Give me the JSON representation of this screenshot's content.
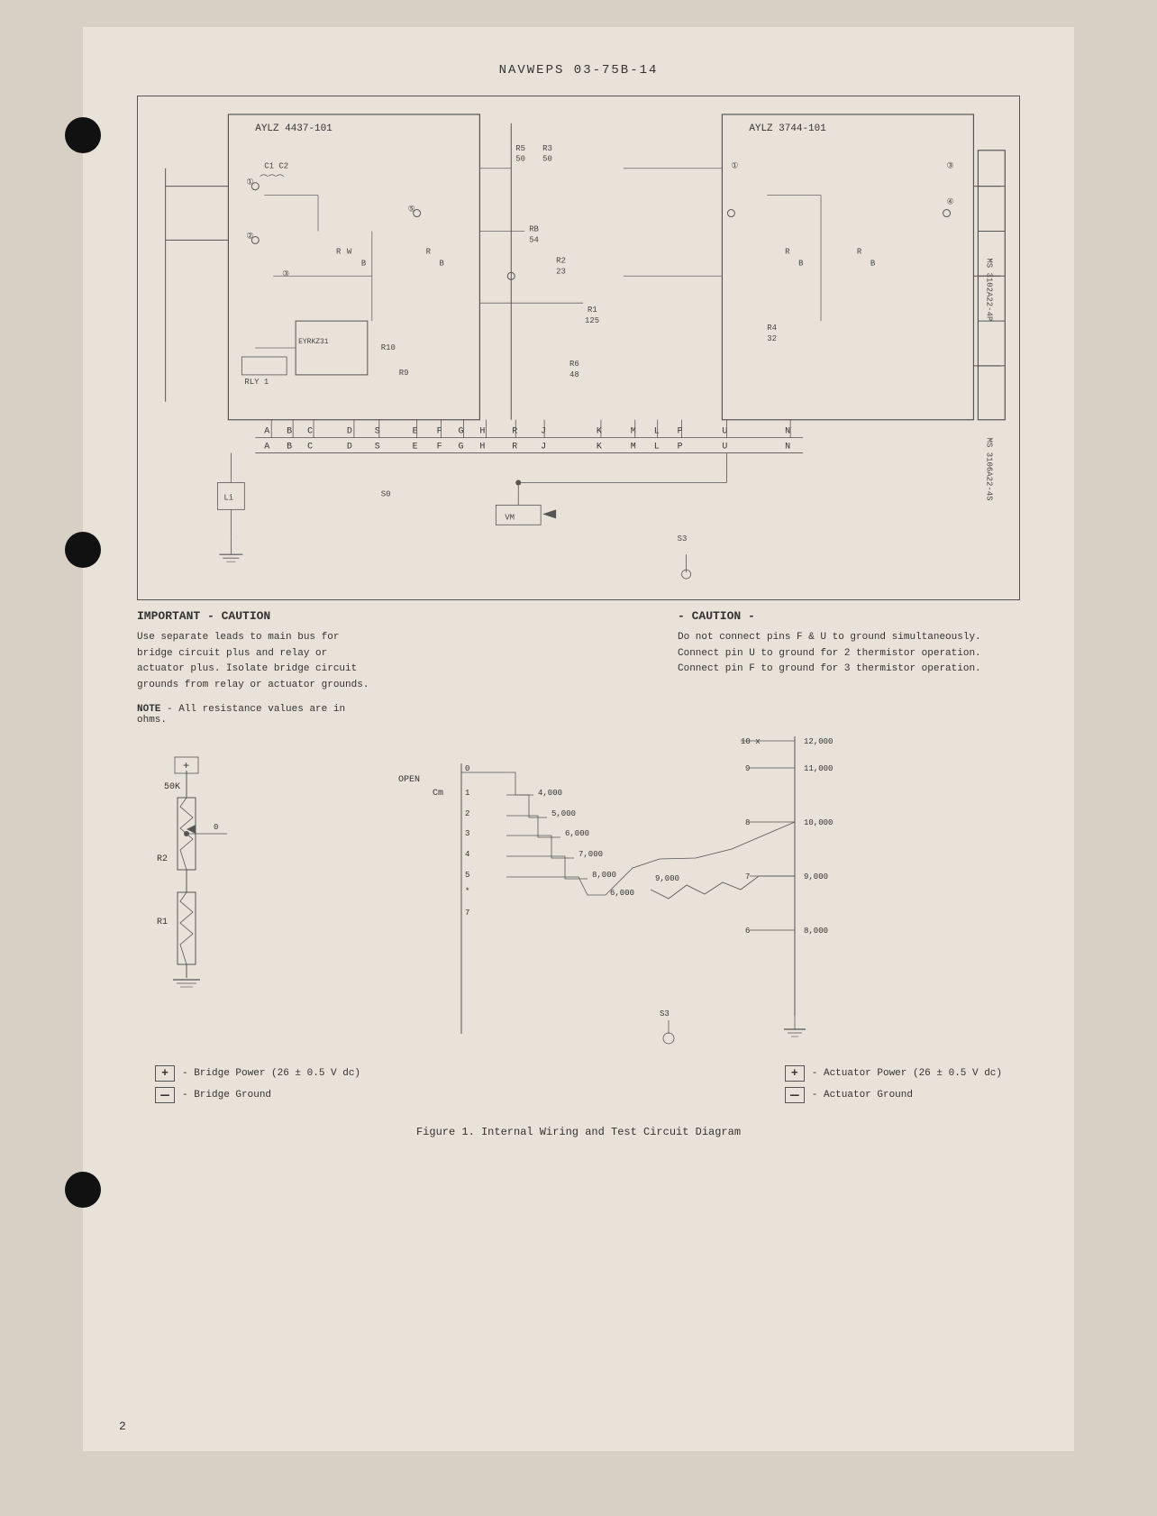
{
  "header": {
    "title": "NAVWEPS 03-75B-14"
  },
  "diagram": {
    "left_module_label": "AYLZ 4437-101",
    "right_module_label": "AYLZ 3744-101",
    "connector_pins_top": [
      "A",
      "B",
      "C",
      "D",
      "S",
      "E",
      "F",
      "G",
      "H",
      "R",
      "J",
      "K",
      "M",
      "L",
      "P",
      "U",
      "N"
    ],
    "connector_pins_bottom": [
      "A",
      "B",
      "C",
      "D",
      "S",
      "E",
      "F",
      "G",
      "H",
      "R",
      "J",
      "K",
      "M",
      "L",
      "P",
      "U",
      "N"
    ],
    "ms_connector_1": "MS 3102A22-4P",
    "ms_connector_2": "MS 3106A22-4S",
    "resistors_left": [
      "R",
      "C1",
      "C2",
      "R10",
      "R9"
    ],
    "resistors_right": [
      "R5 50",
      "R3 50",
      "RB 54",
      "R2 23",
      "R1 125",
      "R6 48",
      "R4 32"
    ],
    "relay_label": "RLY 1",
    "sub_module": "EYRKZ31"
  },
  "important_caution": {
    "title": "IMPORTANT - CAUTION",
    "text": "Use separate leads to main bus for bridge circuit plus and relay or actuator plus. Isolate bridge circuit grounds from relay or actuator grounds.",
    "note_title": "NOTE",
    "note_text": "All resistance values are in ohms."
  },
  "caution_right": {
    "title": "- CAUTION -",
    "text": "Do not connect pins F & U to ground simultaneously. Connect pin U to ground for 2 thermistor operation. Connect pin F to ground for 3 thermistor operation."
  },
  "lower_diagram": {
    "r2_label": "R2",
    "r1_label": "R1",
    "sw_50k": "50K",
    "open_label": "OPEN",
    "cm_label": "Cm",
    "tap_labels": [
      "0",
      "1",
      "2",
      "3",
      "4",
      "5",
      "6",
      "7",
      "8",
      "9",
      "10"
    ],
    "ohm_values": [
      "4,000",
      "5,000",
      "6,000",
      "7,000",
      "8,000",
      "9,000",
      "10,000",
      "11,000",
      "12,000"
    ],
    "resistor_values_right": [
      "12,000",
      "11,000",
      "10,000",
      "9,000",
      "8,000",
      "7,000"
    ],
    "vm_label": "VM",
    "s0_label": "S0",
    "s3_label": "S3",
    "ground_label": "0"
  },
  "legend": {
    "left_items": [
      {
        "symbol": "+",
        "text": "- Bridge Power (26 ± 0.5 V dc)"
      },
      {
        "symbol": "−",
        "text": "- Bridge Ground"
      }
    ],
    "right_items": [
      {
        "symbol": "+",
        "text": "- Actuator Power (26 ± 0.5 V dc)"
      },
      {
        "symbol": "−",
        "text": "- Actuator Ground"
      }
    ]
  },
  "figure_caption": "Figure 1. Internal Wiring and Test Circuit Diagram",
  "page_number": "2",
  "from_label": "from"
}
